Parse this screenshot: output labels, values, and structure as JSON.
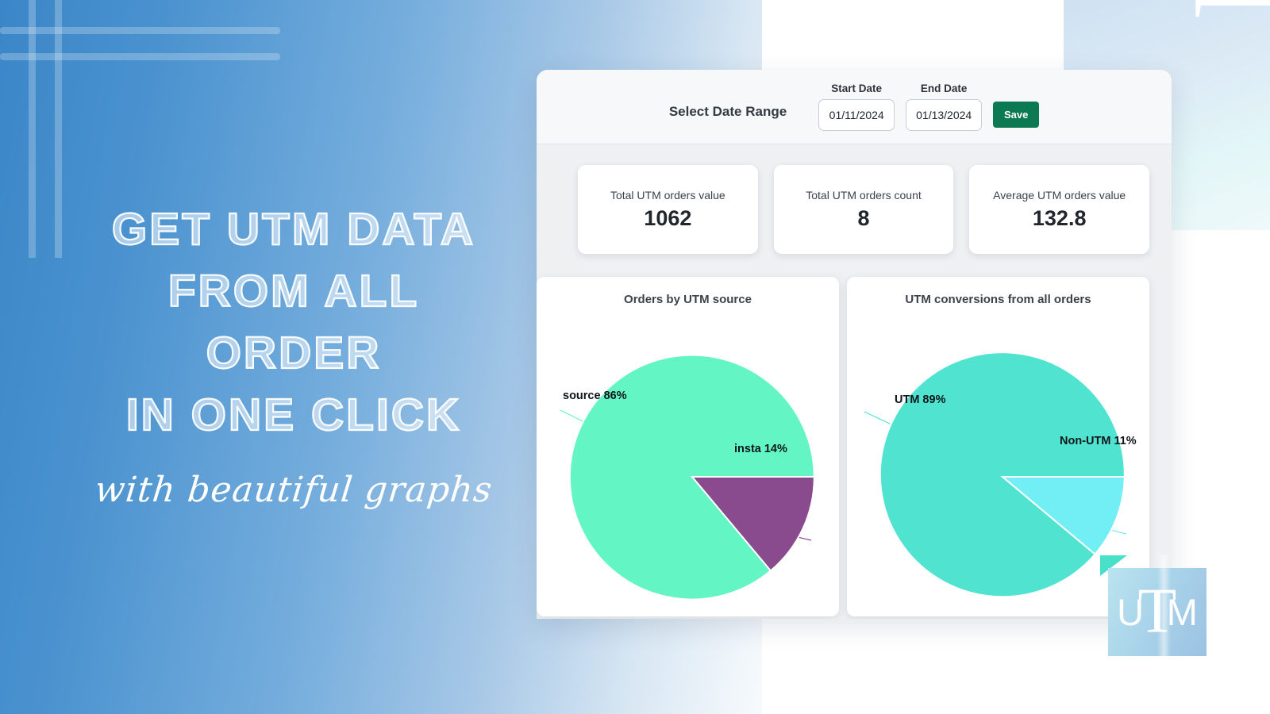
{
  "promo": {
    "headline_lines": [
      "GET UTM DATA",
      "FROM ALL",
      "ORDER",
      "IN ONE CLICK"
    ],
    "subline": "with beautiful graphs"
  },
  "watermark": {
    "text": "UTM"
  },
  "logo": {
    "left": "U",
    "center": "T",
    "right": "M"
  },
  "dashboard": {
    "date_range": {
      "label": "Select Date Range",
      "start_caption": "Start Date",
      "start_value": "01/11/2024",
      "end_caption": "End Date",
      "end_value": "01/13/2024",
      "save_label": "Save"
    },
    "stats": [
      {
        "label": "Total UTM orders value",
        "value": "1062"
      },
      {
        "label": "Total UTM orders count",
        "value": "8"
      },
      {
        "label": "Average UTM orders value",
        "value": "132.8"
      }
    ]
  },
  "colors": {
    "save_green": "#0b7a52",
    "pie_left_primary": "#63f5c4",
    "pie_left_secondary": "#8a4a8e",
    "pie_right_primary": "#4fe3d0",
    "pie_right_secondary": "#72eff5",
    "panel_bg": "#eef0f2"
  },
  "chart_data": [
    {
      "type": "pie",
      "title": "Orders by UTM source",
      "categories": [
        "source",
        "insta"
      ],
      "values": [
        86,
        14
      ],
      "labels": [
        "source 86%",
        "insta 14%"
      ],
      "colors": [
        "#63f5c4",
        "#8a4a8e"
      ],
      "legend": "none",
      "units": "percent"
    },
    {
      "type": "pie",
      "title": "UTM conversions from all orders",
      "categories": [
        "UTM",
        "Non-UTM"
      ],
      "values": [
        89,
        11
      ],
      "labels": [
        "UTM 89%",
        "Non-UTM 11%"
      ],
      "colors": [
        "#4fe3d0",
        "#72eff5"
      ],
      "legend": "none",
      "units": "percent"
    }
  ]
}
